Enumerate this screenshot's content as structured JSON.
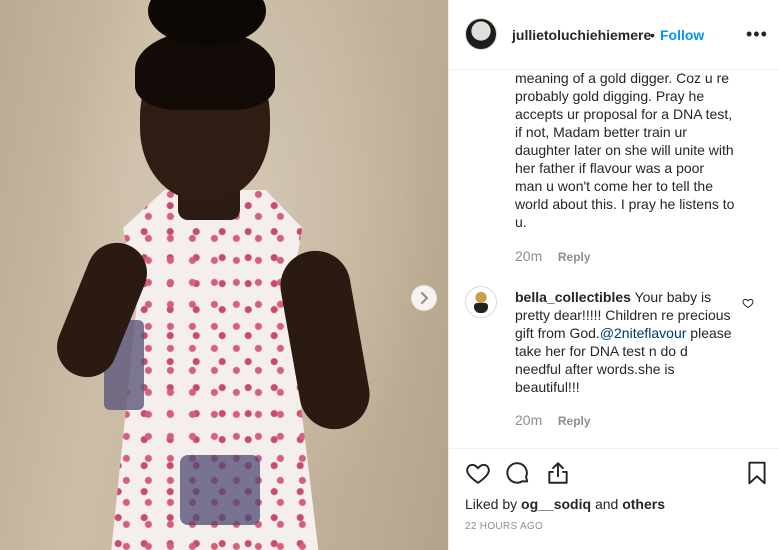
{
  "post": {
    "username": "jullietoluchiehiemere",
    "separator": "•",
    "follow_label": "Follow",
    "more_label": "•••",
    "time": "22 HOURS AGO"
  },
  "comments": [
    {
      "text": "meaning of a gold digger. Coz u re probably gold digging. Pray he accepts ur proposal for a DNA test, if not, Madam better train ur daughter later on she will unite with her father if flavour was a poor man u won't come her to tell the world about this. I pray he listens to u.",
      "time": "20m",
      "reply_label": "Reply"
    },
    {
      "username": "bella_collectibles",
      "text_before": "Your baby is pretty dear!!!!! Children re precious gift from God.",
      "mention": "@2niteflavour",
      "text_after": " please take her for DNA test n do d needful after words.she is beautiful!!!",
      "time": "20m",
      "reply_label": "Reply"
    }
  ],
  "likes": {
    "prefix": "Liked by ",
    "user": "og__sodiq",
    "middle": " and ",
    "others": "others"
  },
  "icons": {
    "next": "chevron-right-icon",
    "like": "heart-icon",
    "comment": "comment-bubble-icon",
    "share": "share-icon",
    "save": "bookmark-icon"
  },
  "colors": {
    "follow": "#0095f6",
    "mention": "#00376b",
    "muted": "#8e8e8e",
    "text": "#262626"
  }
}
